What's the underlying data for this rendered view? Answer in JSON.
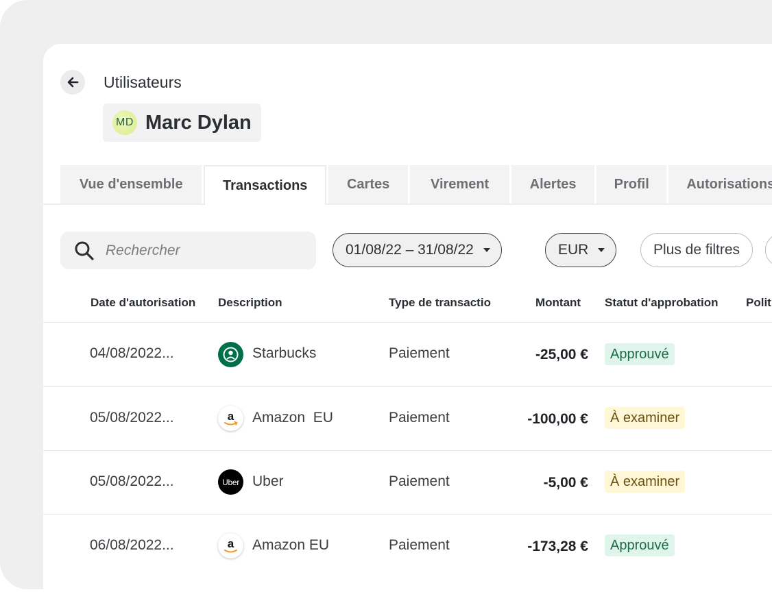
{
  "header": {
    "breadcrumb": "Utilisateurs",
    "avatar_initials": "MD",
    "user_name": "Marc Dylan"
  },
  "tabs": [
    {
      "label": "Vue d'ensemble",
      "active": false
    },
    {
      "label": "Transactions",
      "active": true
    },
    {
      "label": "Cartes",
      "active": false
    },
    {
      "label": "Virement",
      "active": false
    },
    {
      "label": "Alertes",
      "active": false
    },
    {
      "label": "Profil",
      "active": false
    },
    {
      "label": "Autorisations",
      "active": false
    }
  ],
  "filters": {
    "search_placeholder": "Rechercher",
    "date_range": "01/08/22 – 31/08/22",
    "currency": "EUR",
    "more_filters": "Plus de filtres"
  },
  "table": {
    "columns": [
      "Date d'autorisation",
      "Description",
      "Type de transactio",
      "Montant",
      "Statut d'approbation",
      "Polit"
    ],
    "rows": [
      {
        "date": "04/08/2022...",
        "merchant": "Starbucks",
        "logo": "starbucks-logo",
        "type": "Paiement",
        "amount": "-25,00 €",
        "status": "Approuvé",
        "status_kind": "approved"
      },
      {
        "date": "05/08/2022...",
        "merchant": "Amazon  EU",
        "logo": "amazon-logo",
        "type": "Paiement",
        "amount": "-100,00 €",
        "status": "À examiner",
        "status_kind": "review"
      },
      {
        "date": "05/08/2022...",
        "merchant": "Uber",
        "logo": "uber-logo",
        "type": "Paiement",
        "amount": "-5,00 €",
        "status": "À examiner",
        "status_kind": "review"
      },
      {
        "date": "06/08/2022...",
        "merchant": "Amazon EU",
        "logo": "amazon-logo",
        "type": "Paiement",
        "amount": "-173,28 €",
        "status": "Approuvé",
        "status_kind": "approved"
      }
    ]
  },
  "colors": {
    "approved_bg": "#dff4ea",
    "approved_text": "#1d6b47",
    "review_bg": "#fff7d6",
    "review_text": "#6b4f10",
    "starbucks_green": "#00704a",
    "uber_black": "#000000"
  },
  "uber_logo_text": "Uber",
  "amazon_logo_text": "a"
}
